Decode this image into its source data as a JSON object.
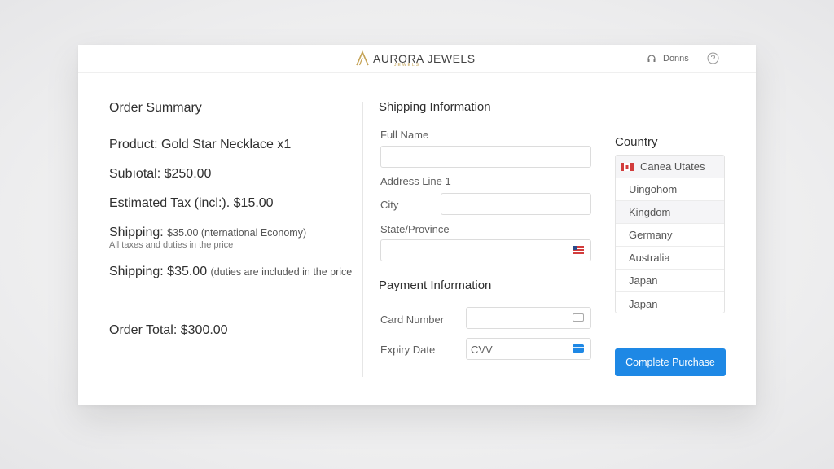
{
  "header": {
    "brand_name": "AURORA JEWELS",
    "brand_sub": "JEWELS",
    "user_label": "Donns"
  },
  "summary": {
    "title": "Order Summary",
    "product": "Product: Gold Star Necklace x1",
    "subtotal": "Subıotal: $250.00",
    "tax": "Estimated Tax (incl:). $15.00",
    "shipping1_main": "Shipping: ",
    "shipping1_detail": "$35.00 (nternational Economy)",
    "shipping1_note": "All taxes and duties in the price",
    "shipping2_main": "Shipping: $35.00 ",
    "shipping2_detail": "(duties are included in the price",
    "total": "Order Total: $300.00"
  },
  "shipping": {
    "title": "Shipping Information",
    "full_name_label": "Full Name",
    "full_name_value": "",
    "address_label": "Address Line 1",
    "city_label": "City",
    "city_value": "",
    "state_label": "State/Province",
    "state_value": ""
  },
  "payment": {
    "title": "Payment Information",
    "card_label": "Card Number",
    "card_value": "",
    "expiry_label": "Expiry Date",
    "cvv_placeholder": "CVV"
  },
  "country": {
    "title": "Country",
    "options": [
      "Canea Utates",
      "Uingohom",
      "Kingdom",
      "Germany",
      "Australia",
      "Japan",
      "Japan"
    ]
  },
  "actions": {
    "complete_label": "Complete Purchase"
  },
  "colors": {
    "accent": "#1e88e5",
    "brand_gold": "#c5a356"
  },
  "icons": {
    "brand": "aurora-logo-icon",
    "user": "headphones-icon",
    "help": "help-circle-icon",
    "state_flag": "us-flag-icon",
    "card": "card-outline-icon",
    "cvv": "credit-card-icon",
    "country_flag": "canada-flag-icon"
  }
}
